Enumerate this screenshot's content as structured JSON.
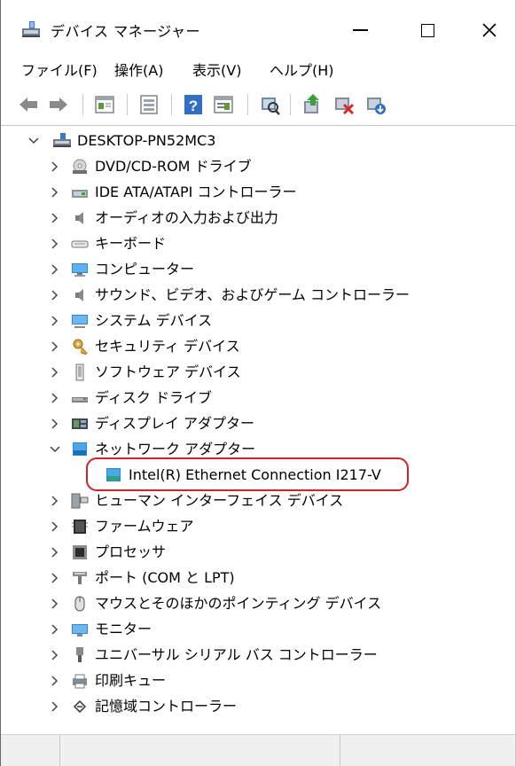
{
  "window": {
    "title": "デバイス マネージャー"
  },
  "menu": [
    "ファイル(F)",
    "操作(A)",
    "表示(V)",
    "ヘルプ(H)"
  ],
  "toolbar": [
    "back-icon",
    "forward-icon",
    "properties-icon",
    "update-icon",
    "help-icon",
    "view-icon",
    "scan-icon",
    "update-driver-icon",
    "disable-icon",
    "uninstall-icon"
  ],
  "tree": {
    "root": "DESKTOP-PN52MC3",
    "items": [
      {
        "label": "DVD/CD-ROM ドライブ",
        "icon": "dvd-icon"
      },
      {
        "label": "IDE ATA/ATAPI コントローラー",
        "icon": "ide-icon"
      },
      {
        "label": "オーディオの入力および出力",
        "icon": "speaker-icon"
      },
      {
        "label": "キーボード",
        "icon": "keyboard-icon"
      },
      {
        "label": "コンピューター",
        "icon": "computer-icon"
      },
      {
        "label": "サウンド、ビデオ、およびゲーム コントローラー",
        "icon": "sound-icon"
      },
      {
        "label": "システム デバイス",
        "icon": "system-icon"
      },
      {
        "label": "セキュリティ デバイス",
        "icon": "security-icon"
      },
      {
        "label": "ソフトウェア デバイス",
        "icon": "software-icon"
      },
      {
        "label": "ディスク ドライブ",
        "icon": "disk-icon"
      },
      {
        "label": "ディスプレイ アダプター",
        "icon": "display-adapter-icon"
      },
      {
        "label": "ネットワーク アダプター",
        "icon": "network-icon"
      },
      {
        "label": "Intel(R) Ethernet Connection I217-V",
        "icon": "network-adapter-icon"
      },
      {
        "label": "ヒューマン インターフェイス デバイス",
        "icon": "hid-icon"
      },
      {
        "label": "ファームウェア",
        "icon": "firmware-icon"
      },
      {
        "label": "プロセッサ",
        "icon": "processor-icon"
      },
      {
        "label": "ポート (COM と LPT)",
        "icon": "port-icon"
      },
      {
        "label": "マウスとそのほかのポインティング デバイス",
        "icon": "mouse-icon"
      },
      {
        "label": "モニター",
        "icon": "monitor-icon"
      },
      {
        "label": "ユニバーサル シリアル バス コントローラー",
        "icon": "usb-icon"
      },
      {
        "label": "印刷キュー",
        "icon": "printer-icon"
      },
      {
        "label": "記憶域コントローラー",
        "icon": "storage-icon"
      }
    ]
  },
  "colors": {
    "accent": "#1e8fd8",
    "highlight": "#d4202a"
  }
}
